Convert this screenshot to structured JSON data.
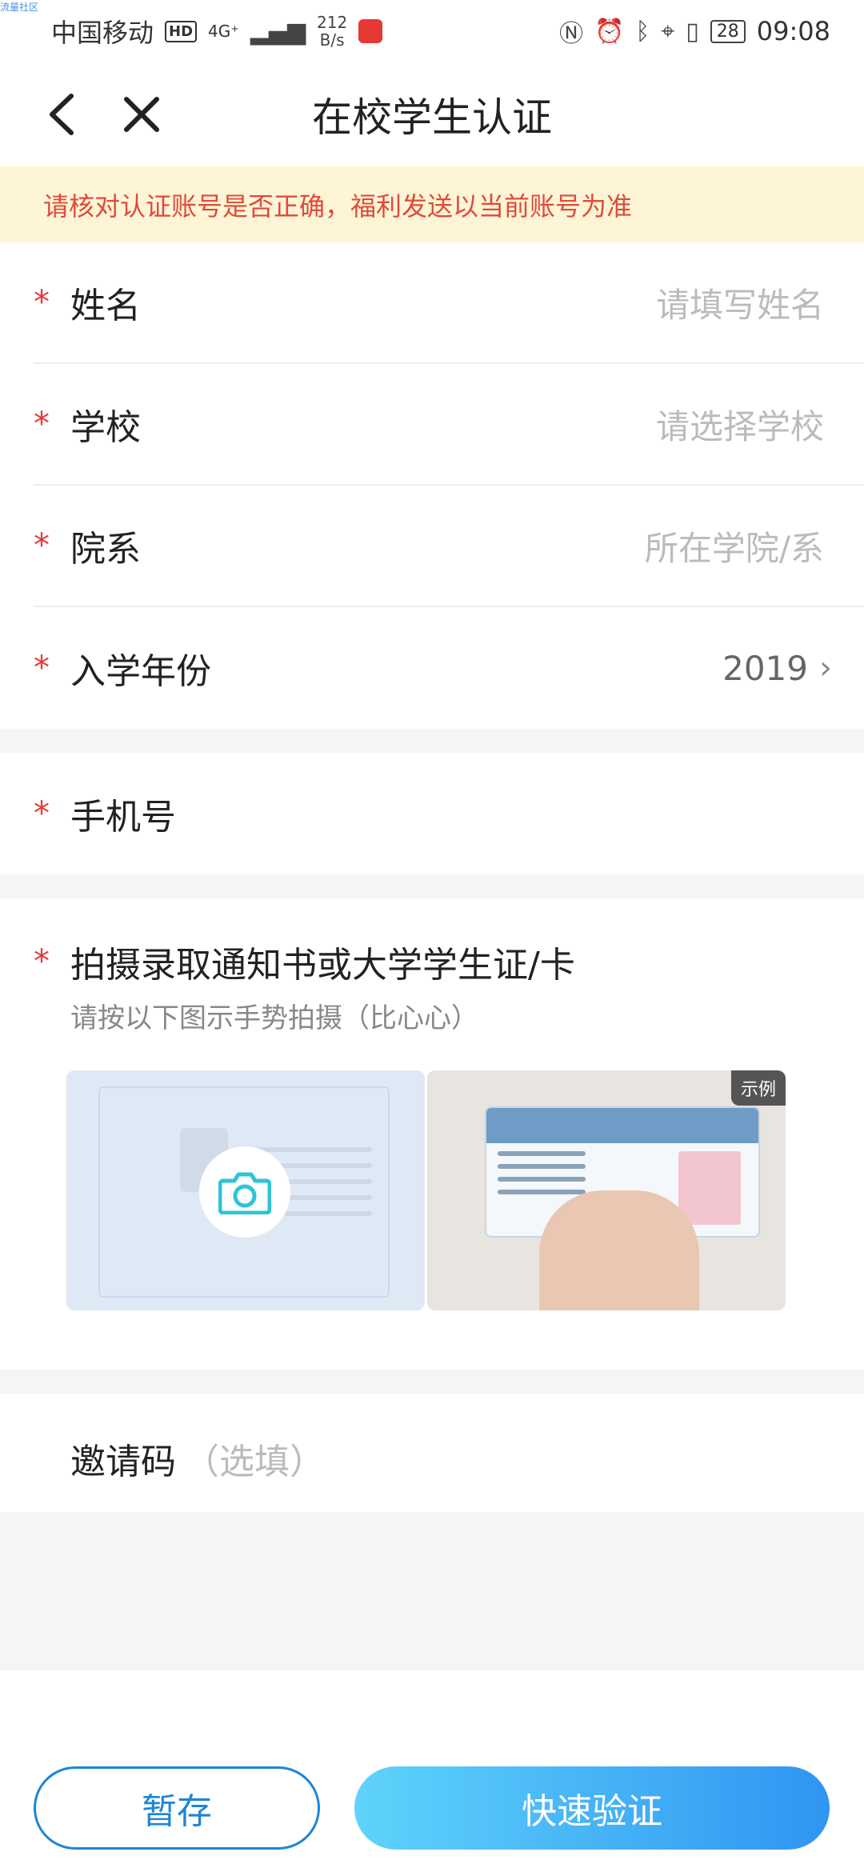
{
  "watermark": "流量社区",
  "status_bar": {
    "carrier": "中国移动",
    "hd_badge": "HD",
    "network": "4G⁺",
    "speed_value": "212",
    "speed_unit": "B/s",
    "battery": "28",
    "time": "09:08"
  },
  "nav": {
    "title": "在校学生认证"
  },
  "notice": "请核对认证账号是否正确，福利发送以当前账号为准",
  "required_mark": "*",
  "fields": {
    "name": {
      "label": "姓名",
      "placeholder": "请填写姓名"
    },
    "school": {
      "label": "学校",
      "placeholder": "请选择学校"
    },
    "department": {
      "label": "院系",
      "placeholder": "所在学院/系"
    },
    "enroll_year": {
      "label": "入学年份",
      "value": "2019"
    },
    "phone": {
      "label": "手机号"
    }
  },
  "photo": {
    "title": "拍摄录取通知书或大学学生证/卡",
    "subtitle": "请按以下图示手势拍摄（比心心）",
    "example_tag": "示例"
  },
  "invite": {
    "label": "邀请码",
    "hint": "（选填）"
  },
  "buttons": {
    "save": "暂存",
    "verify": "快速验证"
  },
  "colors": {
    "accent": "#1e86d6",
    "required": "#e53935",
    "notice_bg": "#fdf5d6",
    "notice_text": "#e04b3b"
  },
  "icons": [
    "back-icon",
    "close-icon",
    "chevron-right-icon",
    "camera-icon"
  ]
}
